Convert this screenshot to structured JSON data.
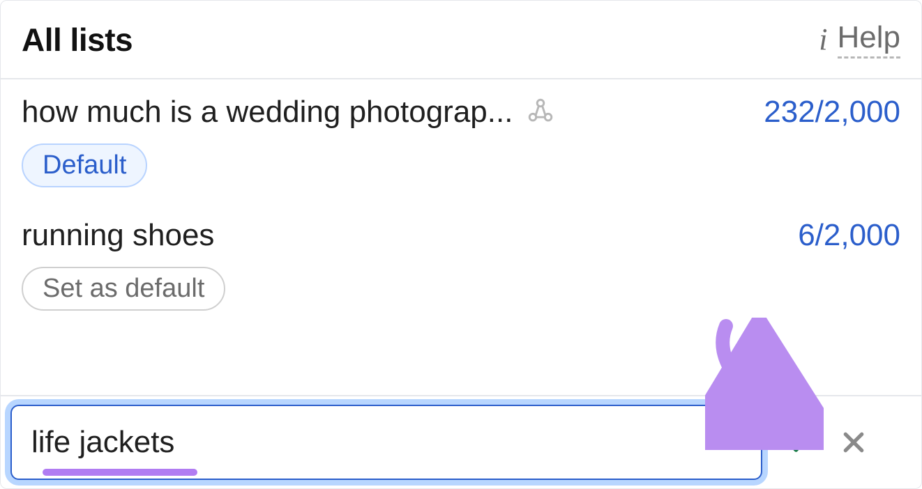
{
  "header": {
    "title": "All lists",
    "help_label": "Help"
  },
  "lists": [
    {
      "name": "how much is a wedding photograp...",
      "count": "232/2,000",
      "is_default": true,
      "badge_label": "Default",
      "shared": true
    },
    {
      "name": "running shoes",
      "count": "6/2,000",
      "is_default": false,
      "set_default_label": "Set as default",
      "shared": false
    }
  ],
  "new_list": {
    "value": "life jackets",
    "placeholder": ""
  },
  "colors": {
    "link": "#2b5ecb",
    "accent_annotation": "#b17cf2",
    "confirm": "#0f7a3e",
    "muted": "#6b6b6b"
  }
}
